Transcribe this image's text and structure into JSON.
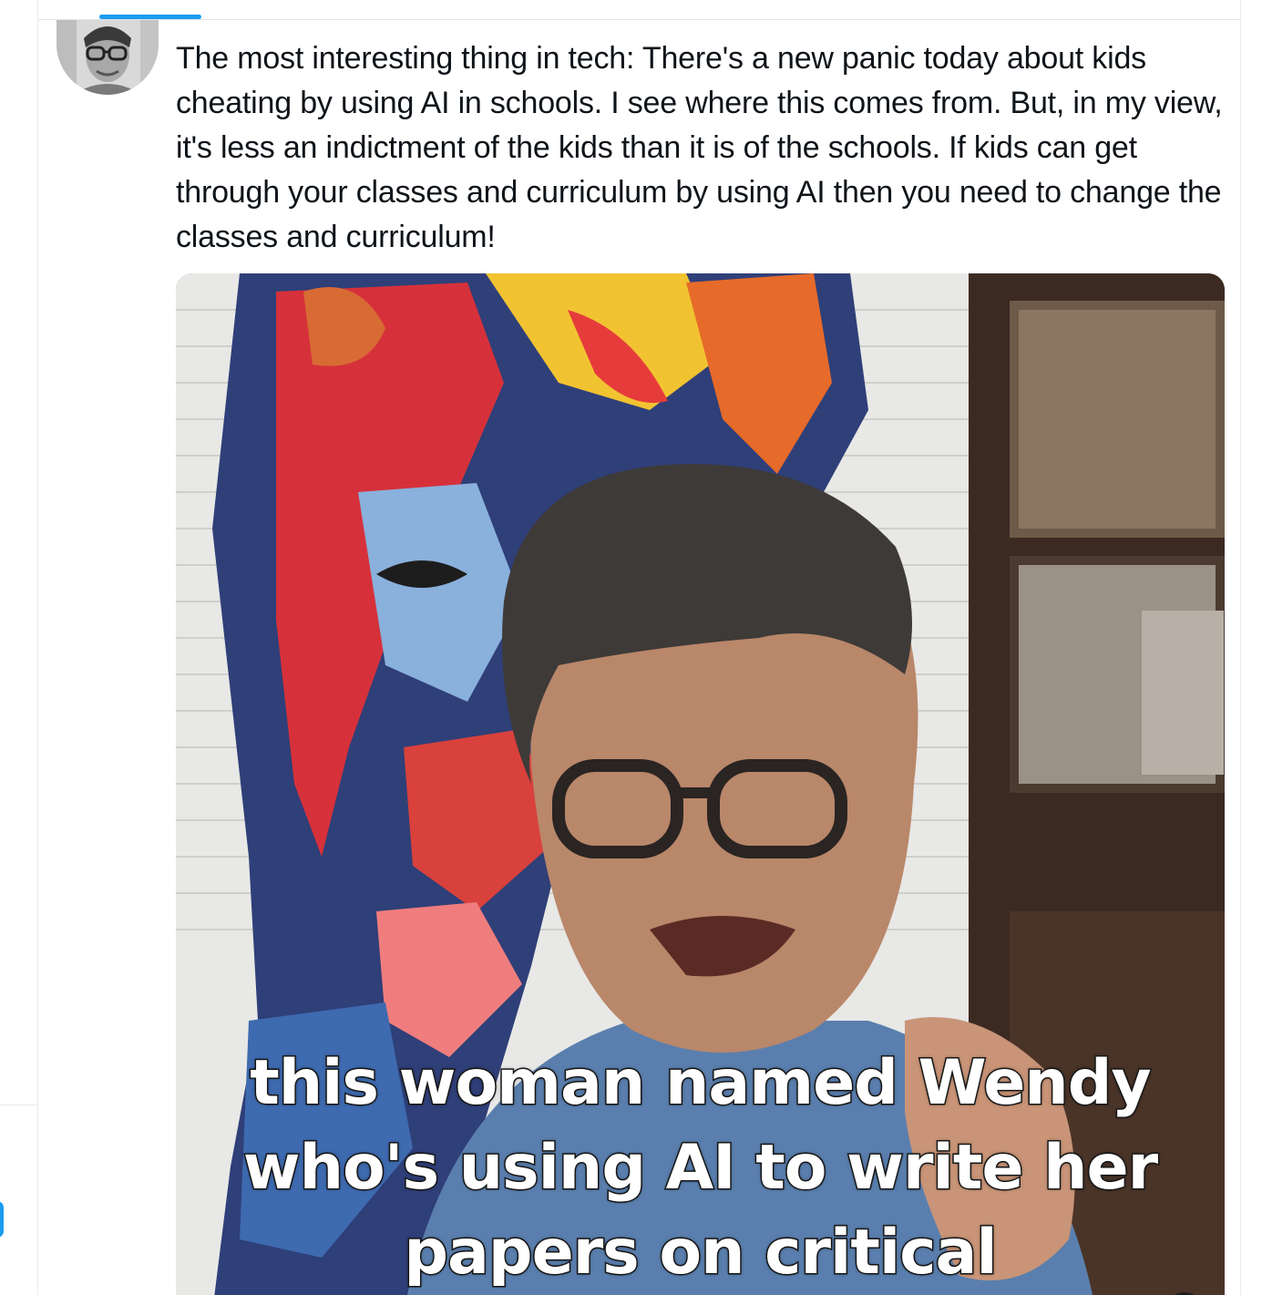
{
  "tweet": {
    "text": "The most interesting thing in tech: There's a new panic today about kids cheating by using AI in schools. I see where this comes from. But, in my view, it's less an indictment of the kids than it is of the schools. If kids can get through your classes and curriculum by using AI then you need to change the classes and curriculum!"
  },
  "video": {
    "caption_lines": [
      "this woman named Wendy",
      "who's using AI to write her",
      "papers on critical"
    ],
    "mute_icon": "volume-muted-icon"
  },
  "colors": {
    "accent": "#1d9bf0",
    "text": "#0f1419",
    "border": "#e6ecf0"
  }
}
